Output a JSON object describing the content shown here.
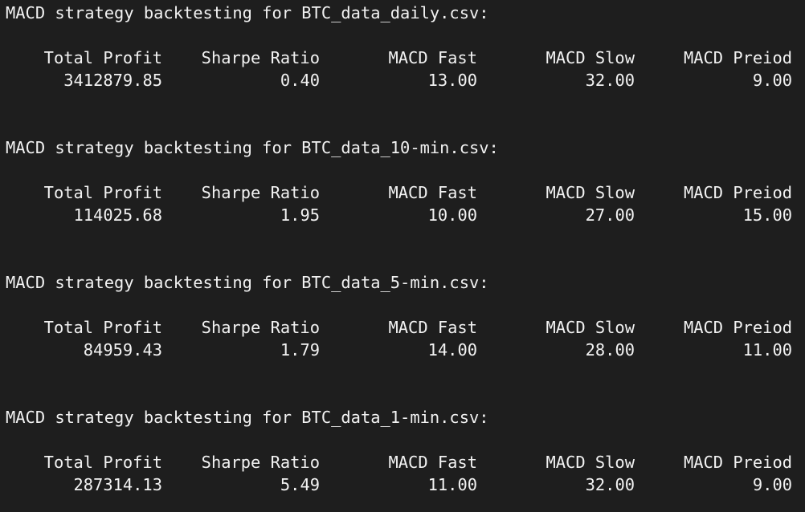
{
  "columns": [
    "Total Profit",
    "Sharpe Ratio",
    "MACD Fast",
    "MACD Slow",
    "MACD Preiod"
  ],
  "blocks": [
    {
      "title": "MACD strategy backtesting for BTC_data_daily.csv:",
      "values": [
        "3412879.85",
        "0.40",
        "13.00",
        "32.00",
        "9.00"
      ]
    },
    {
      "title": "MACD strategy backtesting for BTC_data_10-min.csv:",
      "values": [
        "114025.68",
        "1.95",
        "10.00",
        "27.00",
        "15.00"
      ]
    },
    {
      "title": "MACD strategy backtesting for BTC_data_5-min.csv:",
      "values": [
        "84959.43",
        "1.79",
        "14.00",
        "28.00",
        "11.00"
      ]
    },
    {
      "title": "MACD strategy backtesting for BTC_data_1-min.csv:",
      "values": [
        "287314.13",
        "5.49",
        "11.00",
        "32.00",
        "9.00"
      ]
    }
  ]
}
